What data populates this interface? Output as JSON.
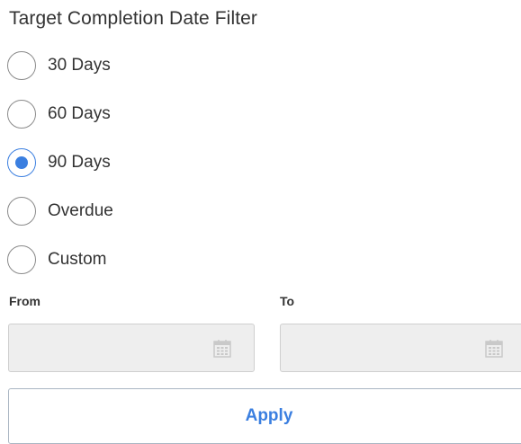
{
  "filter": {
    "title": "Target Completion Date Filter",
    "options": [
      {
        "label": "30 Days",
        "selected": false
      },
      {
        "label": "60 Days",
        "selected": false
      },
      {
        "label": "90 Days",
        "selected": true
      },
      {
        "label": "Overdue",
        "selected": false
      },
      {
        "label": "Custom",
        "selected": false
      }
    ],
    "selected_option": "90 Days"
  },
  "range": {
    "from_label": "From",
    "to_label": "To",
    "from_value": "",
    "to_value": "",
    "from_icon": "calendar-icon",
    "to_icon": "calendar-icon"
  },
  "actions": {
    "apply_label": "Apply"
  },
  "colors": {
    "accent": "#3b7fe0",
    "text": "#333333",
    "disabled_field_bg": "#eeeeee"
  }
}
